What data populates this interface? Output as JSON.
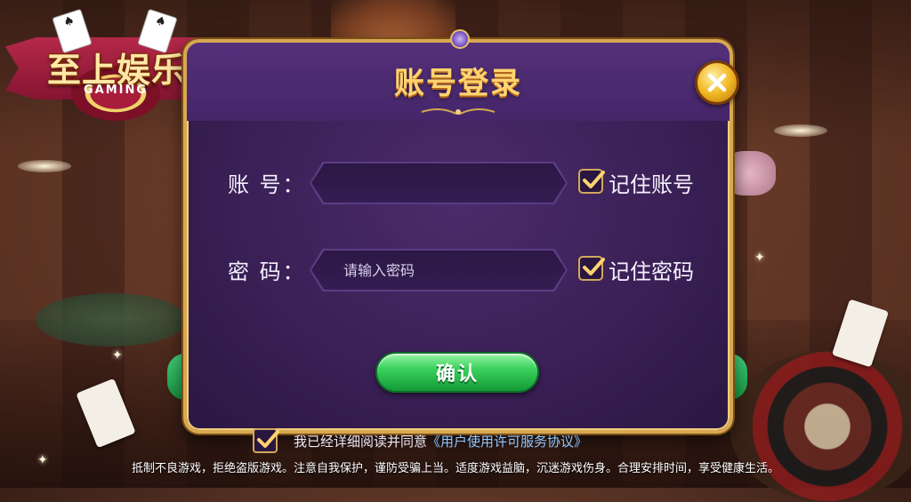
{
  "logo": {
    "title": "至上娱乐",
    "subtitle": "GAMING"
  },
  "dialog": {
    "title": "账号登录",
    "account_label": "账 号：",
    "account_value": "",
    "remember_account_label": "记住账号",
    "remember_account_checked": true,
    "password_label": "密 码：",
    "password_placeholder": "请输入密码",
    "remember_password_label": "记住密码",
    "remember_password_checked": true,
    "confirm_label": "确认"
  },
  "agreement": {
    "checked": true,
    "text": "我已经详细阅读并同意",
    "link": "《用户使用许可服务协议》"
  },
  "footer": {
    "notice": "抵制不良游戏，拒绝盗版游戏。注意自我保护，谨防受骗上当。适度游戏益脑，沉迷游戏伤身。合理安排时间，享受健康生活。"
  },
  "colors": {
    "dialog_bg": "#3a2056",
    "gold_border": "#d8a852",
    "title_gold": "#ffd36f",
    "confirm_green": "#3bd25e",
    "link_blue": "#8fc7ff"
  },
  "icons": {
    "close": "close-icon",
    "check": "checkmark-icon"
  }
}
